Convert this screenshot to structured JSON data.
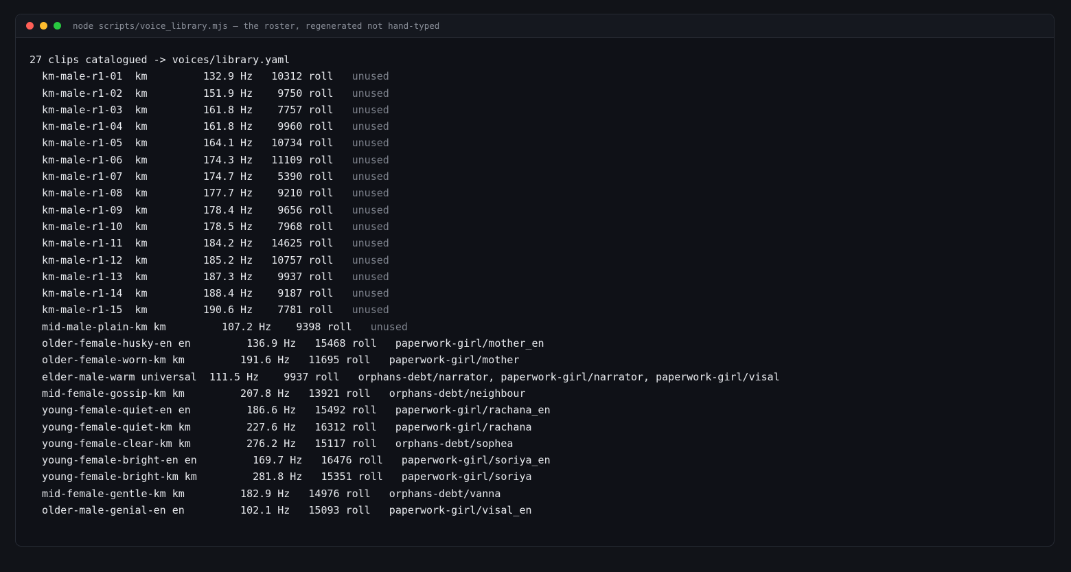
{
  "window": {
    "title": "node scripts/voice_library.mjs — the roster, regenerated not hand-typed",
    "controls": {
      "close_color": "#ff5f57",
      "minimize_color": "#febc2e",
      "maximize_color": "#28c840"
    }
  },
  "terminal": {
    "header_line": "27 clips catalogued -> voices/library.yaml",
    "rows": [
      {
        "main": "  km-male-r1-01  km         132.9 Hz   10312 roll   ",
        "note": "unused",
        "muted": true
      },
      {
        "main": "  km-male-r1-02  km         151.9 Hz    9750 roll   ",
        "note": "unused",
        "muted": true
      },
      {
        "main": "  km-male-r1-03  km         161.8 Hz    7757 roll   ",
        "note": "unused",
        "muted": true
      },
      {
        "main": "  km-male-r1-04  km         161.8 Hz    9960 roll   ",
        "note": "unused",
        "muted": true
      },
      {
        "main": "  km-male-r1-05  km         164.1 Hz   10734 roll   ",
        "note": "unused",
        "muted": true
      },
      {
        "main": "  km-male-r1-06  km         174.3 Hz   11109 roll   ",
        "note": "unused",
        "muted": true
      },
      {
        "main": "  km-male-r1-07  km         174.7 Hz    5390 roll   ",
        "note": "unused",
        "muted": true
      },
      {
        "main": "  km-male-r1-08  km         177.7 Hz    9210 roll   ",
        "note": "unused",
        "muted": true
      },
      {
        "main": "  km-male-r1-09  km         178.4 Hz    9656 roll   ",
        "note": "unused",
        "muted": true
      },
      {
        "main": "  km-male-r1-10  km         178.5 Hz    7968 roll   ",
        "note": "unused",
        "muted": true
      },
      {
        "main": "  km-male-r1-11  km         184.2 Hz   14625 roll   ",
        "note": "unused",
        "muted": true
      },
      {
        "main": "  km-male-r1-12  km         185.2 Hz   10757 roll   ",
        "note": "unused",
        "muted": true
      },
      {
        "main": "  km-male-r1-13  km         187.3 Hz    9937 roll   ",
        "note": "unused",
        "muted": true
      },
      {
        "main": "  km-male-r1-14  km         188.4 Hz    9187 roll   ",
        "note": "unused",
        "muted": true
      },
      {
        "main": "  km-male-r1-15  km         190.6 Hz    7781 roll   ",
        "note": "unused",
        "muted": true
      },
      {
        "main": "  mid-male-plain-km km         107.2 Hz    9398 roll   ",
        "note": "unused",
        "muted": true
      },
      {
        "main": "  older-female-husky-en en         136.9 Hz   15468 roll   ",
        "note": "paperwork-girl/mother_en",
        "muted": false
      },
      {
        "main": "  older-female-worn-km km         191.6 Hz   11695 roll   ",
        "note": "paperwork-girl/mother",
        "muted": false
      },
      {
        "main": "  elder-male-warm universal  111.5 Hz    9937 roll   ",
        "note": "orphans-debt/narrator, paperwork-girl/narrator, paperwork-girl/visal",
        "muted": false
      },
      {
        "main": "  mid-female-gossip-km km         207.8 Hz   13921 roll   ",
        "note": "orphans-debt/neighbour",
        "muted": false
      },
      {
        "main": "  young-female-quiet-en en         186.6 Hz   15492 roll   ",
        "note": "paperwork-girl/rachana_en",
        "muted": false
      },
      {
        "main": "  young-female-quiet-km km         227.6 Hz   16312 roll   ",
        "note": "paperwork-girl/rachana",
        "muted": false
      },
      {
        "main": "  young-female-clear-km km         276.2 Hz   15117 roll   ",
        "note": "orphans-debt/sophea",
        "muted": false
      },
      {
        "main": "  young-female-bright-en en         169.7 Hz   16476 roll   ",
        "note": "paperwork-girl/soriya_en",
        "muted": false
      },
      {
        "main": "  young-female-bright-km km         281.8 Hz   15351 roll   ",
        "note": "paperwork-girl/soriya",
        "muted": false
      },
      {
        "main": "  mid-female-gentle-km km         182.9 Hz   14976 roll   ",
        "note": "orphans-debt/vanna",
        "muted": false
      },
      {
        "main": "  older-male-genial-en en         102.1 Hz   15093 roll   ",
        "note": "paperwork-girl/visal_en",
        "muted": false
      }
    ]
  }
}
